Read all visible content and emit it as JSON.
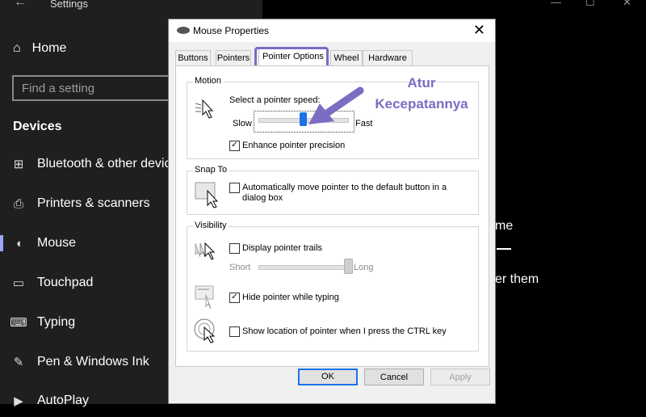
{
  "settings": {
    "app_title": "Settings",
    "home": "Home",
    "search_placeholder": "Find a setting",
    "section": "Devices",
    "nav": [
      {
        "label": "Bluetooth & other devices",
        "icon": "bluetooth-devices-icon"
      },
      {
        "label": "Printers & scanners",
        "icon": "printer-icon"
      },
      {
        "label": "Mouse",
        "icon": "mouse-icon",
        "active": true
      },
      {
        "label": "Touchpad",
        "icon": "touchpad-icon"
      },
      {
        "label": "Typing",
        "icon": "keyboard-icon"
      },
      {
        "label": "Pen & Windows Ink",
        "icon": "pen-icon"
      },
      {
        "label": "AutoPlay",
        "icon": "autoplay-icon"
      }
    ],
    "right_fragment_1": "me",
    "right_fragment_2": "er them"
  },
  "dialog": {
    "title": "Mouse Properties",
    "tabs": [
      "Buttons",
      "Pointers",
      "Pointer Options",
      "Wheel",
      "Hardware"
    ],
    "active_tab": "Pointer Options",
    "motion": {
      "label": "Motion",
      "speed_label": "Select a pointer speed:",
      "slow": "Slow",
      "fast": "Fast",
      "speed_fraction": 0.5,
      "precision_label": "Enhance pointer precision",
      "precision_checked": true
    },
    "snap": {
      "label": "Snap To",
      "text_line1": "Automatically move pointer to the default button in a",
      "text_line2": "dialog box",
      "checked": false
    },
    "visibility": {
      "label": "Visibility",
      "trails_label": "Display pointer trails",
      "trails_checked": false,
      "short": "Short",
      "long": "Long",
      "trails_fraction": 1.0,
      "hide_label": "Hide pointer while typing",
      "hide_checked": true,
      "ctrl_label": "Show location of pointer when I press the CTRL key",
      "ctrl_checked": false
    },
    "buttons": {
      "ok": "OK",
      "cancel": "Cancel",
      "apply": "Apply"
    }
  },
  "annotation": {
    "line1": "Atur",
    "line2": "Kecepatannya",
    "color": "#7b6cc4"
  }
}
